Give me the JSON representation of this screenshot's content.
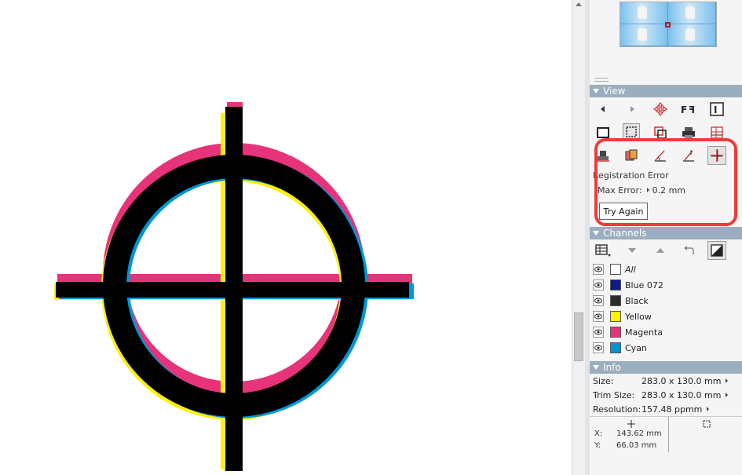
{
  "view": {
    "title": "View",
    "tools": [
      {
        "name": "back-icon"
      },
      {
        "name": "forward-icon"
      },
      {
        "name": "pan-icon"
      },
      {
        "name": "flip-icon"
      },
      {
        "name": "text-info-icon"
      },
      {
        "name": "page-frame-icon"
      },
      {
        "name": "trim-box-icon"
      },
      {
        "name": "separations-icon"
      },
      {
        "name": "print-icon"
      },
      {
        "name": "grid-icon"
      },
      {
        "name": "stamp-icon"
      },
      {
        "name": "overlay-icon"
      },
      {
        "name": "angle-icon"
      },
      {
        "name": "measure-icon"
      },
      {
        "name": "registration-icon"
      }
    ]
  },
  "registration": {
    "title": "Registration Error",
    "max_error_label": "Max Error:",
    "max_error_value": "0.2 mm",
    "try_again_label": "Try Again"
  },
  "channels": {
    "title": "Channels",
    "items": [
      {
        "label": "All",
        "color": "#ffffff"
      },
      {
        "label": "Blue 072",
        "color": "#0d1b8c"
      },
      {
        "label": "Black",
        "color": "#2b2b2b"
      },
      {
        "label": "Yellow",
        "color": "#fff200"
      },
      {
        "label": "Magenta",
        "color": "#e6337a"
      },
      {
        "label": "Cyan",
        "color": "#0096d6"
      }
    ]
  },
  "info": {
    "title": "Info",
    "size_label": "Size:",
    "size_value": "283.0 x 130.0 mm",
    "trim_label": "Trim Size:",
    "trim_value": "283.0 x 130.0 mm",
    "resolution_label": "Resolution:",
    "resolution_value": "157.48 ppmm",
    "x_label": "X:",
    "x_value": "143.62 mm",
    "y_label": "Y:",
    "y_value": "66.03 mm"
  },
  "colors": {
    "magenta": "#e6337a",
    "yellow": "#fff200",
    "cyan": "#0096d6",
    "black": "#000000",
    "highlight": "#ef3b3b",
    "header": "#9aaebf"
  }
}
